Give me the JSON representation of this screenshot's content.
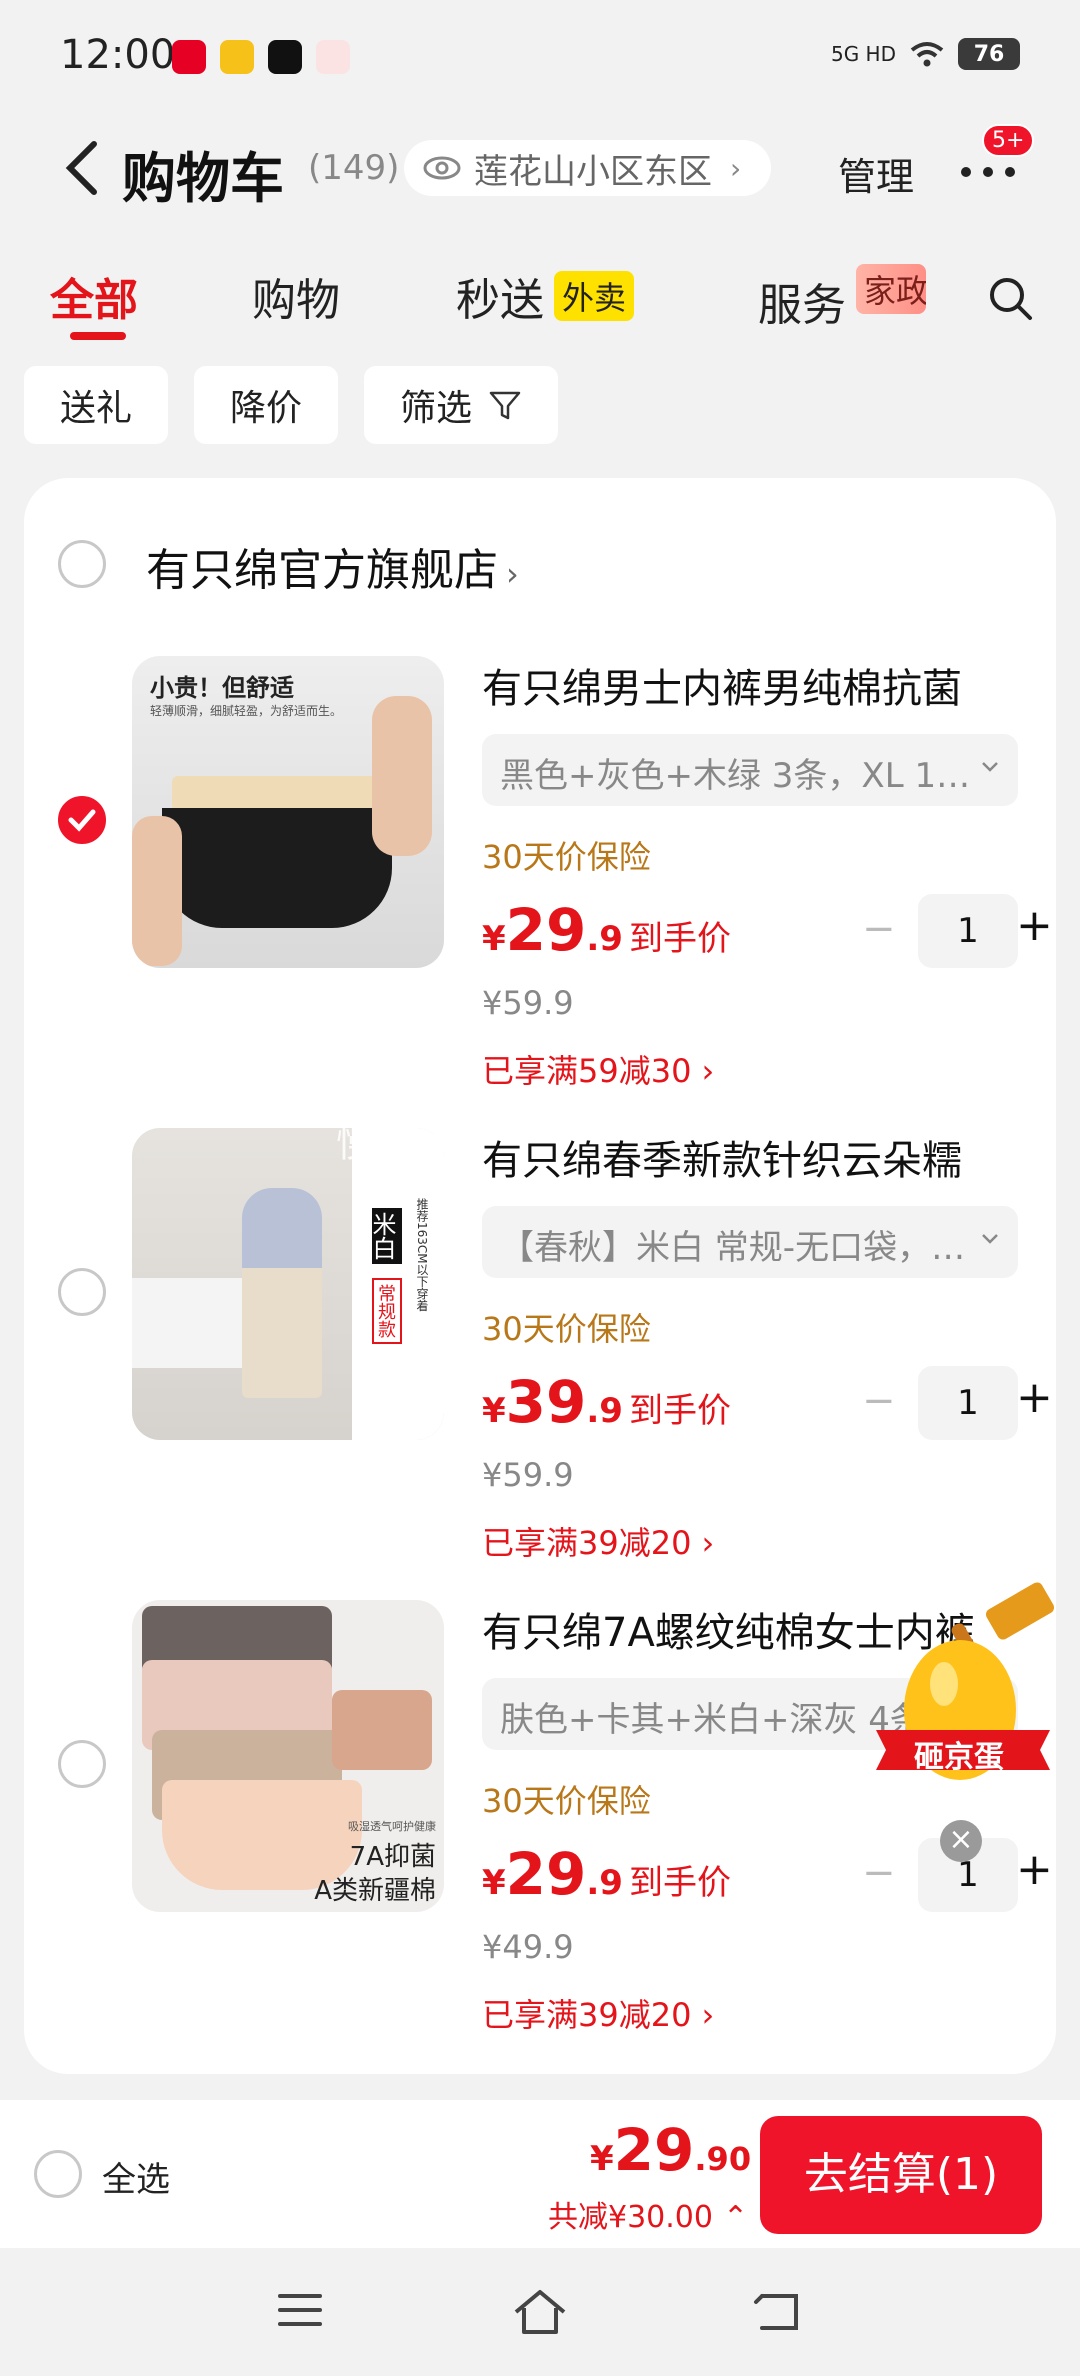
{
  "status": {
    "time": "12:00",
    "network": "5G HD",
    "battery": "76"
  },
  "header": {
    "title": "购物车",
    "count": "(149)",
    "location": "莲花山小区东区",
    "manage": "管理",
    "badge": "5+"
  },
  "tabs": [
    {
      "label": "全部"
    },
    {
      "label": "购物"
    },
    {
      "label": "秒送",
      "tag": "外卖"
    },
    {
      "label": "服务",
      "tag": "家政"
    }
  ],
  "filters": [
    "送礼",
    "降价",
    "筛选"
  ],
  "store": {
    "name": "有只绵官方旗舰店"
  },
  "items": [
    {
      "name": "有只绵男士内裤男纯棉抗菌",
      "spec": "黑色+灰色+木绿 3条，XL 1…",
      "insure": "30天价保险",
      "price_int": "29",
      "price_dec": ".9",
      "price_note": "到手价",
      "orig": "¥59.9",
      "promo": "已享满59减30",
      "qty": "1",
      "checked": true,
      "thumb_text_top": "小贵！但舒适",
      "thumb_text_sub": "轻薄顺滑，细腻轻盈，为舒适而生。"
    },
    {
      "name": "有只绵春季新款针织云朵糯",
      "spec": "【春秋】米白 常规-无口袋，…",
      "insure": "30天价保险",
      "price_int": "39",
      "price_dec": ".9",
      "price_note": "到手价",
      "orig": "¥59.9",
      "promo": "已享满39减20",
      "qty": "1",
      "checked": false,
      "thumb_text_a": "米白",
      "thumb_text_b": "常规款",
      "thumb_text_c": "推荐163CM以下穿着"
    },
    {
      "name": "有只绵7A螺纹纯棉女士内裤",
      "spec": "肤色+卡其+米白+深灰 4条",
      "insure": "30天价保险",
      "price_int": "29",
      "price_dec": ".9",
      "price_note": "到手价",
      "orig": "¥49.9",
      "promo": "已享满39减20",
      "qty": "1",
      "checked": false,
      "thumb_text_a": "吸湿透气呵护健康",
      "thumb_text_b": "7A抑菌",
      "thumb_text_c": "A类新疆棉"
    }
  ],
  "watermark": "慢星人",
  "egg": {
    "label": "砸京蛋"
  },
  "bottom": {
    "select_all": "全选",
    "currency": "¥",
    "total_int": "29",
    "total_dec": ".90",
    "saved": "共减¥30.00",
    "checkout": "去结算(1)"
  },
  "colors": {
    "accent": "#f0142b",
    "price": "#e4141b",
    "insure": "#b8781a"
  }
}
